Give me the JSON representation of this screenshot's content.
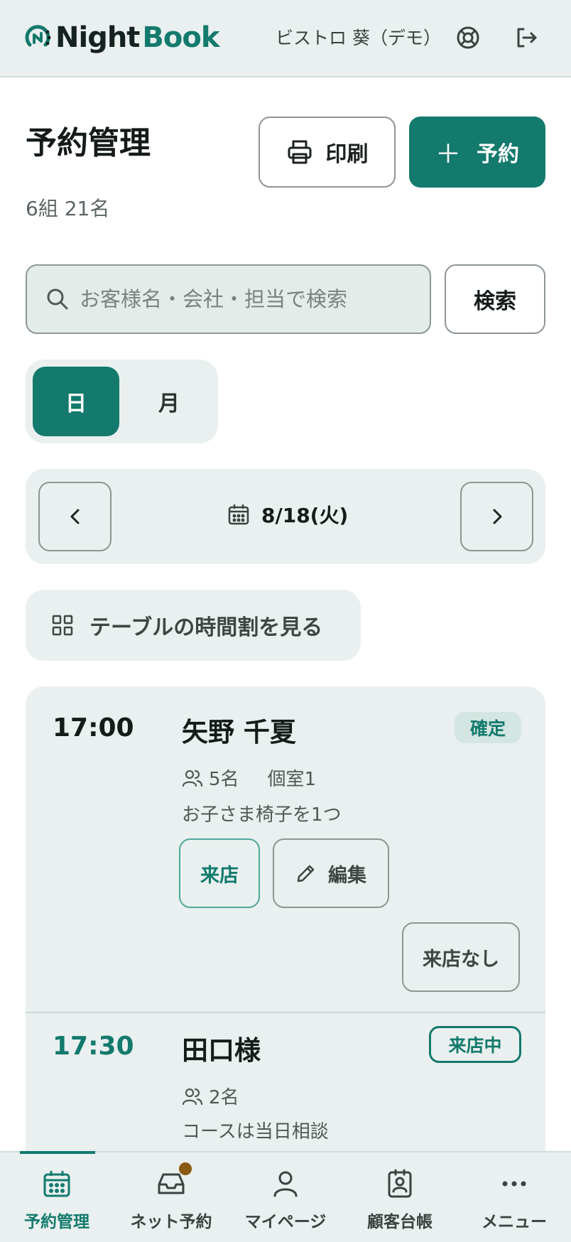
{
  "header": {
    "logo_night": "Night",
    "logo_book": "Book",
    "store_name": "ビストロ 葵（デモ）",
    "help_icon": "lifebuoy-icon",
    "logout_icon": "logout-icon"
  },
  "page": {
    "title": "予約管理",
    "summary": "6組 21名",
    "print_label": "印刷",
    "add_label": "予約"
  },
  "search": {
    "placeholder": "お客様名・会社・担当で検索",
    "value": "",
    "button_label": "検索"
  },
  "view_toggle": {
    "day_label": "日",
    "month_label": "月",
    "selected": "日"
  },
  "date_nav": {
    "date": "8/18(火)"
  },
  "table_view_label": "テーブルの時間割を見る",
  "reservations": [
    {
      "time": "17:00",
      "name": "矢野 千夏",
      "status": "確定",
      "party": "5名",
      "room": "個室1",
      "note": "お子さま椅子を1つ",
      "visit_label": "来店",
      "edit_label": "編集",
      "noshow_label": "来店なし"
    },
    {
      "time": "17:30",
      "name": "田口様",
      "status": "来店中",
      "party": "2名",
      "note": "コースは当日相談"
    }
  ],
  "bottom_nav": [
    {
      "label": "予約管理",
      "icon": "calendar-icon",
      "active": true
    },
    {
      "label": "ネット予約",
      "icon": "inbox-icon",
      "active": false,
      "has_notification": true
    },
    {
      "label": "マイページ",
      "icon": "user-icon",
      "active": false
    },
    {
      "label": "顧客台帳",
      "icon": "customer-ledger-icon",
      "active": false
    },
    {
      "label": "メニュー",
      "icon": "more-icon",
      "active": false
    }
  ],
  "colors": {
    "brand": "#137a6d",
    "surface": "#e9f0ef",
    "border": "#8d9693",
    "notification": "#8a5a14"
  }
}
